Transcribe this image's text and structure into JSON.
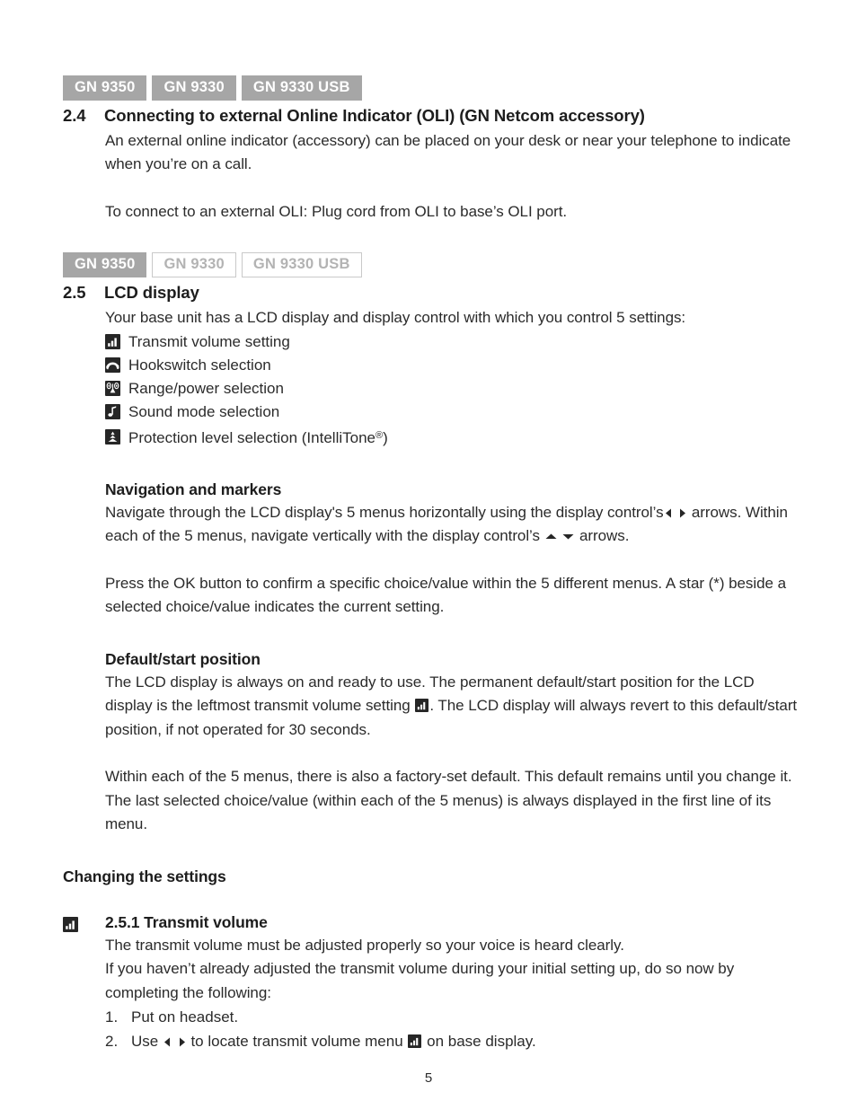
{
  "document": {
    "page_number": "5"
  },
  "badges_row1": [
    {
      "label": "GN 9350",
      "style": "filled"
    },
    {
      "label": "GN 9330",
      "style": "filled"
    },
    {
      "label": "GN 9330 USB",
      "style": "filled"
    }
  ],
  "badges_row2": [
    {
      "label": "GN 9350",
      "style": "filled"
    },
    {
      "label": "GN 9330",
      "style": "outline"
    },
    {
      "label": "GN 9330 USB",
      "style": "outline"
    }
  ],
  "section_24": {
    "number": "2.4",
    "title": "Connecting to external Online Indicator (OLI) (GN Netcom accessory)",
    "paragraph1": "An external online indicator (accessory) can be placed on your desk or near your telephone to indicate when you’re on a call.",
    "paragraph2": "To connect to an external OLI: Plug cord from OLI to base’s OLI port."
  },
  "section_25": {
    "number": "2.5",
    "title": "LCD display",
    "intro": "Your base unit has a LCD display and display control with which you control 5 settings:",
    "settings": [
      {
        "icon": "transmit-volume-icon",
        "label": "Transmit volume setting"
      },
      {
        "icon": "hookswitch-icon",
        "label": "Hookswitch selection"
      },
      {
        "icon": "range-power-icon",
        "label": "Range/power selection"
      },
      {
        "icon": "sound-mode-icon",
        "label": "Sound mode selection"
      },
      {
        "icon": "protection-level-icon",
        "label": "Protection level selection (IntelliTone®)"
      }
    ],
    "protection_label_before": "Protection level selection (IntelliTone",
    "protection_label_sup": "®",
    "protection_label_after": ")",
    "navigation": {
      "heading": "Navigation and markers",
      "para_part1": "Navigate through the LCD display's 5 menus horizontally using the display control’s",
      "para_part2": "arrows. Within each of the 5 menus, navigate vertically with the display control’s",
      "para_part3": "arrows.",
      "para2": "Press the OK button to confirm a specific choice/value within the 5 different menus. A star (*) beside a selected choice/value indicates the current setting."
    },
    "default_position": {
      "heading": "Default/start position",
      "para_part1": "The LCD display is always on and ready to use. The permanent default/start position for the LCD display is the leftmost transmit volume setting",
      "para_part2": ". The LCD display will always revert to this default/start position, if not operated for 30 seconds.",
      "para2": "Within each of the 5 menus, there is also a factory-set default. This default remains until you change it. The last selected choice/value (within each of the 5 menus) is always displayed in the first line of its menu."
    }
  },
  "changing_settings": {
    "heading": "Changing the settings"
  },
  "section_251": {
    "icon": "transmit-volume-icon",
    "title": "2.5.1 Transmit volume",
    "para1": "The transmit volume must be adjusted properly so your voice is heard clearly.",
    "para2": "If you haven’t already adjusted the transmit volume during your initial setting up, do so now by completing the following:",
    "steps": [
      {
        "num": "1.",
        "text_before": "Put on headset.",
        "text_after": "",
        "has_arrows": false,
        "has_icon": false
      },
      {
        "num": "2.",
        "text_before": "Use",
        "text_middle": "to locate transmit volume menu",
        "text_after": "on base display.",
        "has_arrows": true,
        "has_icon": true
      }
    ]
  },
  "colors": {
    "badge_filled_bg": "#a6a6a6",
    "badge_outline_border": "#c9c9c9",
    "badge_outline_text": "#b3b3b3",
    "text": "#2b2b2b",
    "heading": "#1d1d1d",
    "icon_bg": "#262626"
  }
}
